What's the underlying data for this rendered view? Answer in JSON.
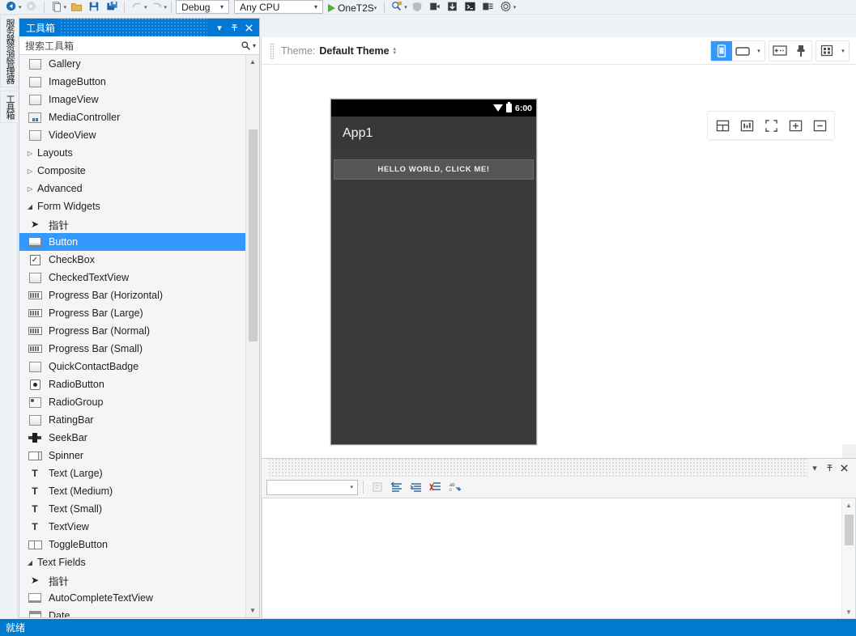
{
  "toolbar": {
    "debug_config": "Debug",
    "platform": "Any CPU",
    "device_target": "OneT2S",
    "icons": [
      "back-navigate-icon",
      "forward-navigate-icon",
      "new-file-icon",
      "open-folder-icon",
      "save-icon",
      "save-all-icon",
      "undo-icon",
      "redo-icon",
      "start-debug-icon",
      "search-icon",
      "attach-process-icon",
      "step-over-icon",
      "step-into-icon",
      "console-icon",
      "output-icon",
      "layers-icon"
    ]
  },
  "vertical_dock": {
    "tabs": [
      {
        "label": "服务器资源管理器",
        "name": "server-explorer"
      },
      {
        "label": "工具箱",
        "name": "toolbox"
      }
    ]
  },
  "toolbox": {
    "title": "工具箱",
    "window_buttons": [
      "chevron-down-icon",
      "pin-icon",
      "close-icon"
    ],
    "search": {
      "placeholder": "搜索工具箱",
      "icons": [
        "search-icon",
        "chevron-down-icon"
      ]
    },
    "items": [
      {
        "type": "item",
        "label": "Gallery",
        "icon": "box-widget-icon",
        "indent": 1,
        "selected": false
      },
      {
        "type": "item",
        "label": "ImageButton",
        "icon": "box-widget-icon",
        "indent": 1,
        "selected": false
      },
      {
        "type": "item",
        "label": "ImageView",
        "icon": "box-widget-icon",
        "indent": 1,
        "selected": false
      },
      {
        "type": "item",
        "label": "MediaController",
        "icon": "media-widget-icon",
        "indent": 1,
        "selected": false
      },
      {
        "type": "item",
        "label": "VideoView",
        "icon": "box-widget-icon",
        "indent": 1,
        "selected": false
      },
      {
        "type": "group",
        "label": "Layouts",
        "expanded": false
      },
      {
        "type": "group",
        "label": "Composite",
        "expanded": false
      },
      {
        "type": "group",
        "label": "Advanced",
        "expanded": false
      },
      {
        "type": "group",
        "label": "Form Widgets",
        "expanded": true
      },
      {
        "type": "item",
        "label": "指针",
        "icon": "pointer-icon",
        "indent": 1,
        "selected": false
      },
      {
        "type": "item",
        "label": "Button",
        "icon": "button-widget-icon",
        "indent": 1,
        "selected": true
      },
      {
        "type": "item",
        "label": "CheckBox",
        "icon": "checkbox-widget-icon",
        "indent": 1,
        "selected": false
      },
      {
        "type": "item",
        "label": "CheckedTextView",
        "icon": "box-widget-icon",
        "indent": 1,
        "selected": false
      },
      {
        "type": "item",
        "label": "Progress Bar (Horizontal)",
        "icon": "progressbar-widget-icon",
        "indent": 1,
        "selected": false
      },
      {
        "type": "item",
        "label": "Progress Bar (Large)",
        "icon": "progressbar-widget-icon",
        "indent": 1,
        "selected": false
      },
      {
        "type": "item",
        "label": "Progress Bar (Normal)",
        "icon": "progressbar-widget-icon",
        "indent": 1,
        "selected": false
      },
      {
        "type": "item",
        "label": "Progress Bar (Small)",
        "icon": "progressbar-widget-icon",
        "indent": 1,
        "selected": false
      },
      {
        "type": "item",
        "label": "QuickContactBadge",
        "icon": "box-widget-icon",
        "indent": 1,
        "selected": false
      },
      {
        "type": "item",
        "label": "RadioButton",
        "icon": "radio-widget-icon",
        "indent": 1,
        "selected": false
      },
      {
        "type": "item",
        "label": "RadioGroup",
        "icon": "radiogroup-widget-icon",
        "indent": 1,
        "selected": false
      },
      {
        "type": "item",
        "label": "RatingBar",
        "icon": "box-widget-icon",
        "indent": 1,
        "selected": false
      },
      {
        "type": "item",
        "label": "SeekBar",
        "icon": "seekbar-widget-icon",
        "indent": 1,
        "selected": false
      },
      {
        "type": "item",
        "label": "Spinner",
        "icon": "spinner-widget-icon",
        "indent": 1,
        "selected": false
      },
      {
        "type": "item",
        "label": "Text (Large)",
        "icon": "text-widget-icon",
        "indent": 1,
        "selected": false
      },
      {
        "type": "item",
        "label": "Text (Medium)",
        "icon": "text-widget-icon",
        "indent": 1,
        "selected": false
      },
      {
        "type": "item",
        "label": "Text (Small)",
        "icon": "text-widget-icon",
        "indent": 1,
        "selected": false
      },
      {
        "type": "item",
        "label": "TextView",
        "icon": "text-widget-icon",
        "indent": 1,
        "selected": false
      },
      {
        "type": "item",
        "label": "ToggleButton",
        "icon": "toggle-widget-icon",
        "indent": 1,
        "selected": false
      },
      {
        "type": "group",
        "label": "Text Fields",
        "expanded": true
      },
      {
        "type": "item",
        "label": "指针",
        "icon": "pointer-icon",
        "indent": 1,
        "selected": false
      },
      {
        "type": "item",
        "label": "AutoCompleteTextView",
        "icon": "autocomplete-widget-icon",
        "indent": 1,
        "selected": false
      },
      {
        "type": "item",
        "label": "Date",
        "icon": "date-widget-icon",
        "indent": 1,
        "selected": false
      }
    ]
  },
  "designer": {
    "theme_label": "Theme:",
    "theme_value": "Default Theme",
    "orientation_buttons": [
      {
        "name": "portrait-orientation-button",
        "icon": "phone-portrait-icon",
        "active": true
      },
      {
        "name": "landscape-orientation-button",
        "icon": "phone-landscape-icon",
        "active": false
      }
    ],
    "tool_buttons": [
      {
        "name": "device-frame-button",
        "icon": "device-frame-icon"
      },
      {
        "name": "render-brush-button",
        "icon": "paintbrush-icon"
      },
      {
        "name": "grid-layout-button",
        "icon": "grid-icon"
      }
    ],
    "float_toolbar": [
      {
        "name": "split-view-button",
        "icon": "split-view-icon"
      },
      {
        "name": "outline-view-button",
        "icon": "outline-view-icon"
      },
      {
        "name": "fit-screen-button",
        "icon": "fit-screen-icon"
      },
      {
        "name": "zoom-in-button",
        "icon": "zoom-in-icon"
      },
      {
        "name": "zoom-out-button",
        "icon": "zoom-out-icon"
      }
    ],
    "preview": {
      "status_time": "6:00",
      "app_title": "App1",
      "button_text": "HELLO WORLD, CLICK ME!",
      "status_icons": [
        "wifi-icon",
        "battery-icon"
      ],
      "colors": {
        "status_bar": "#000000",
        "action_bar": "#383838",
        "background": "#3a3a3a",
        "button": "#565656"
      }
    }
  },
  "bottom_panel": {
    "window_buttons": [
      "chevron-down-icon",
      "pin-icon",
      "close-icon"
    ],
    "combo_value": "",
    "toolbar_icons": [
      {
        "name": "clear-output-button",
        "icon": "clear-icon",
        "disabled": true
      },
      {
        "name": "toggle-wordwrap-button",
        "icon": "wordwrap-left-icon",
        "disabled": false
      },
      {
        "name": "toggle-indent-button",
        "icon": "indent-icon",
        "disabled": false
      },
      {
        "name": "clear-all-button",
        "icon": "clear-all-icon",
        "disabled": false
      },
      {
        "name": "find-button",
        "icon": "find-next-icon",
        "disabled": false
      }
    ]
  },
  "statusbar": {
    "text": "就绪"
  },
  "colors": {
    "accent": "#0078d4",
    "status_bar": "#007acc",
    "selection": "#3399ff",
    "panel_bg": "#f5f5f5"
  }
}
